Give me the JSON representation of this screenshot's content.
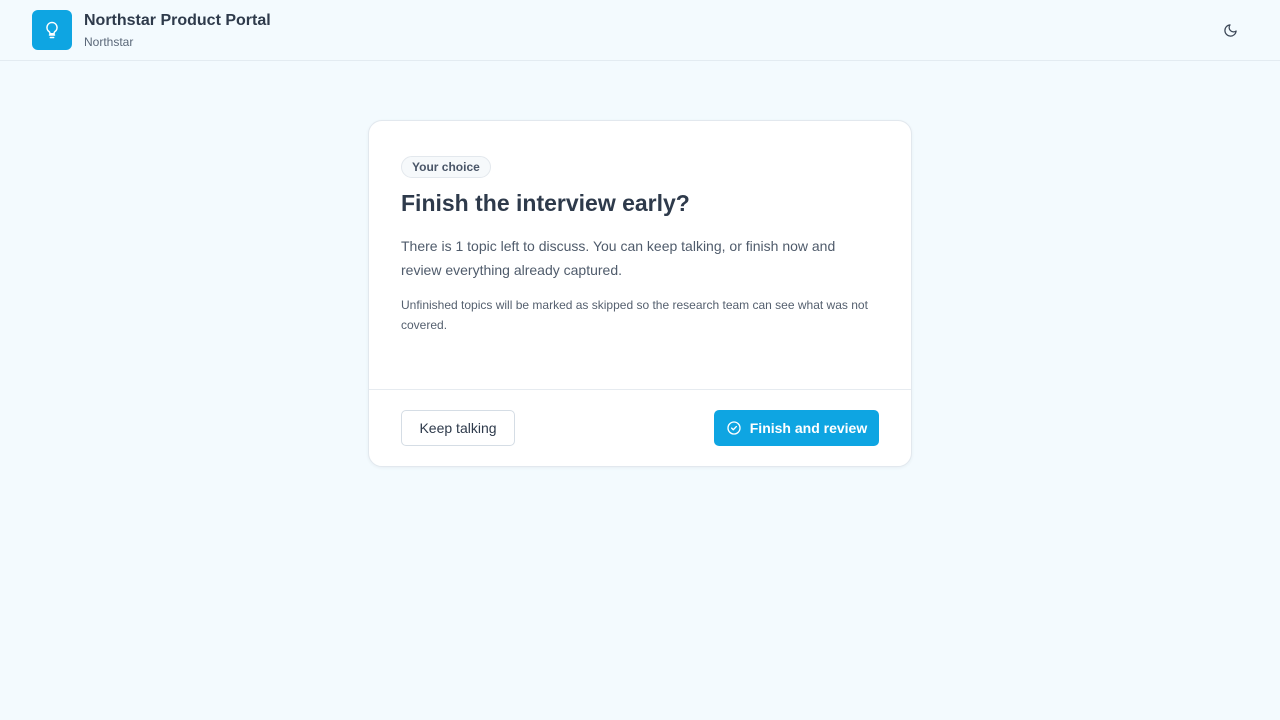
{
  "header": {
    "title": "Northstar Product Portal",
    "subtitle": "Northstar",
    "logo_icon": "lightbulb-icon",
    "theme_toggle_icon": "moon-icon"
  },
  "dialog": {
    "badge": "Your choice",
    "title": "Finish the interview early?",
    "body": "There is 1 topic left to discuss. You can keep talking, or finish now and review everything already captured.",
    "note": "Unfinished topics will be marked as skipped so the research team can see what was not covered.",
    "secondary_button": "Keep talking",
    "primary_button": "Finish and review",
    "primary_icon": "check-circle-icon"
  },
  "colors": {
    "accent": "#0ea5e2",
    "background": "#f3fafe",
    "text": "#2e3a4b"
  }
}
